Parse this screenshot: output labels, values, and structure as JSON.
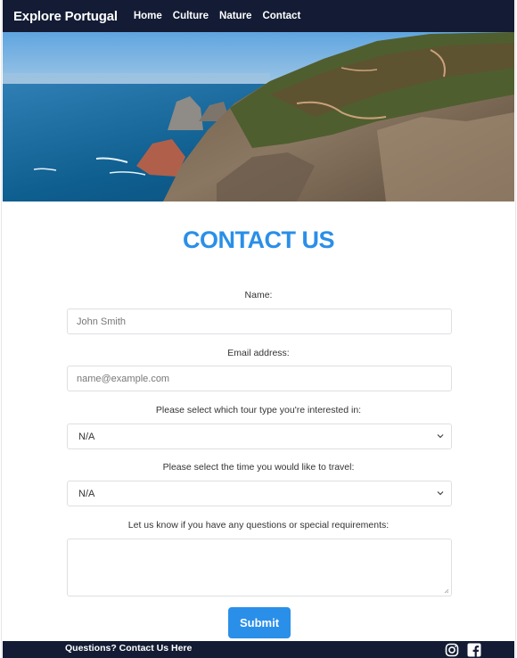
{
  "navbar": {
    "brand": "Explore Portugal",
    "links": [
      "Home",
      "Culture",
      "Nature",
      "Contact"
    ]
  },
  "hero": {
    "image": "coastal-cliffs-ocean-photo"
  },
  "page": {
    "title": "CONTACT US"
  },
  "form": {
    "name_label": "Name:",
    "name_placeholder": "John Smith",
    "email_label": "Email address:",
    "email_placeholder": "name@example.com",
    "tour_label": "Please select which tour type you're interested in:",
    "tour_value": "N/A",
    "time_label": "Please select the time you would like to travel:",
    "time_value": "N/A",
    "questions_label": "Let us know if you have any questions or special requirements:",
    "questions_value": "",
    "submit_label": "Submit"
  },
  "footer": {
    "link": "Questions? Contact Us Here",
    "icons": [
      "instagram-icon",
      "facebook-icon"
    ]
  },
  "colors": {
    "navbar": "#131c34",
    "accent": "#2a8fe8"
  }
}
